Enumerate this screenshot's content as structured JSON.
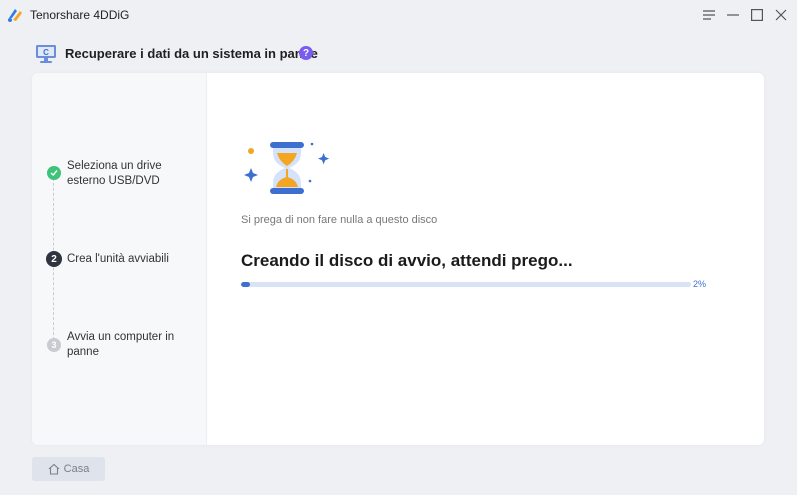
{
  "window": {
    "title": "Tenorshare 4DDiG"
  },
  "header": {
    "title": "Recuperare i dati da un sistema in panne",
    "help_icon": "question-icon",
    "help_text": "?"
  },
  "steps": [
    {
      "number": "✓",
      "label": "Seleziona un drive esterno USB/DVD",
      "status": "done"
    },
    {
      "number": "2",
      "label": "Crea l'unità avviabili",
      "status": "active"
    },
    {
      "number": "3",
      "label": "Avvia un computer in panne",
      "status": "pending"
    }
  ],
  "main": {
    "notice": "Si prega di non fare nulla a questo disco",
    "progress_title": "Creando il disco di avvio, attendi prego...",
    "progress_value": 0.02,
    "progress_label": "2%"
  },
  "footer": {
    "home_label": "Casa"
  },
  "colors": {
    "accent": "#3d6fd0",
    "step_done": "#3fc37a",
    "help_badge": "#7a5cf0"
  }
}
